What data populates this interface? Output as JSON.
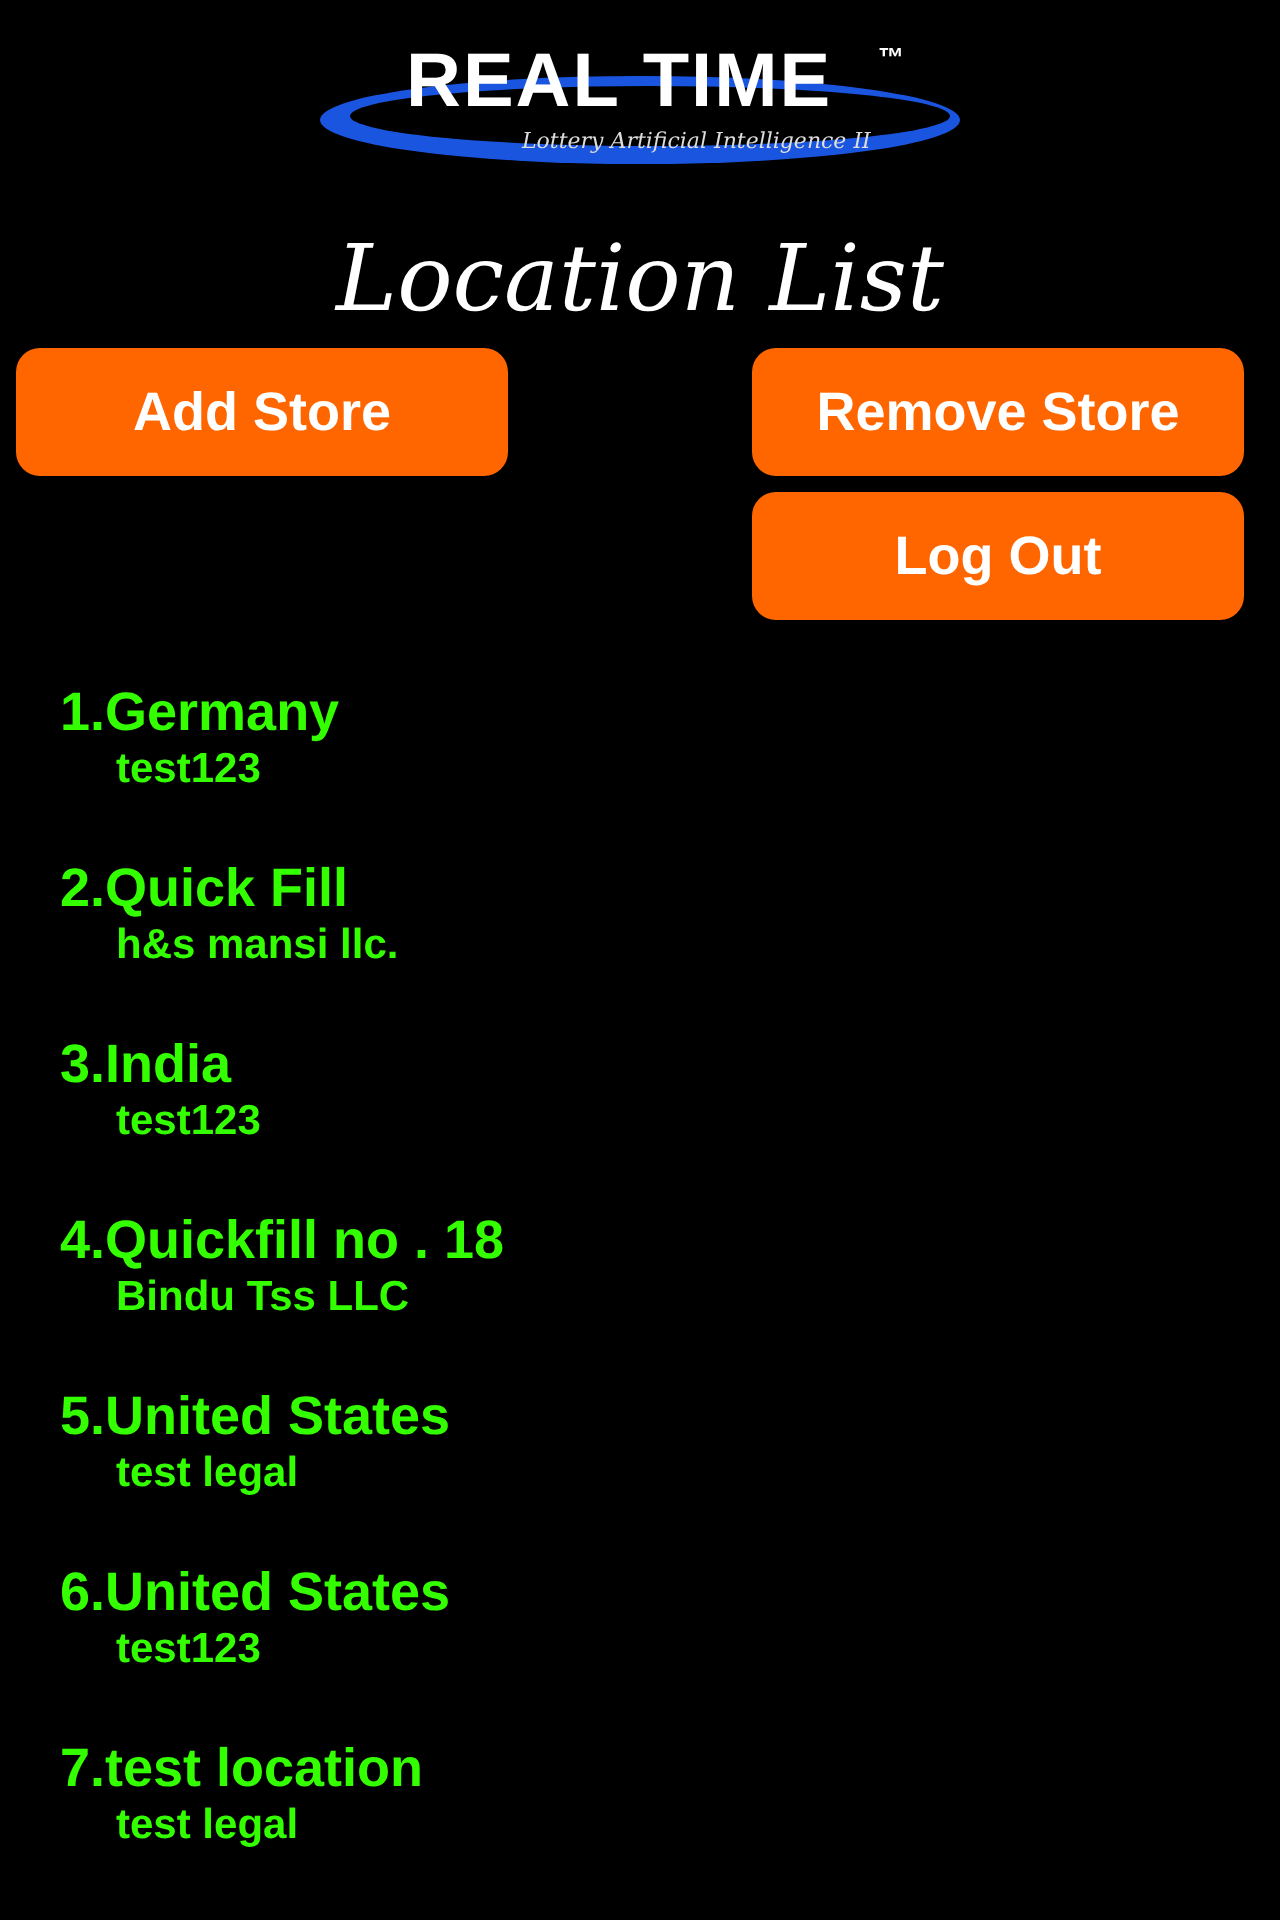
{
  "logo": {
    "title": "REAL TIME",
    "trademark": "™",
    "tagline": "Lottery Artificial Intelligence  II"
  },
  "heading": "Location List",
  "buttons": {
    "add": "Add Store",
    "remove": "Remove Store",
    "logout": "Log Out"
  },
  "locations": [
    {
      "name": "1.Germany",
      "owner": "test123"
    },
    {
      "name": "2.Quick Fill",
      "owner": "h&s mansi llc."
    },
    {
      "name": "3.India",
      "owner": "test123"
    },
    {
      "name": "4.Quickfill no . 18",
      "owner": "Bindu Tss LLC"
    },
    {
      "name": "5.United States",
      "owner": "test legal"
    },
    {
      "name": "6.United States",
      "owner": "test123"
    },
    {
      "name": "7.test location",
      "owner": "test legal"
    }
  ]
}
